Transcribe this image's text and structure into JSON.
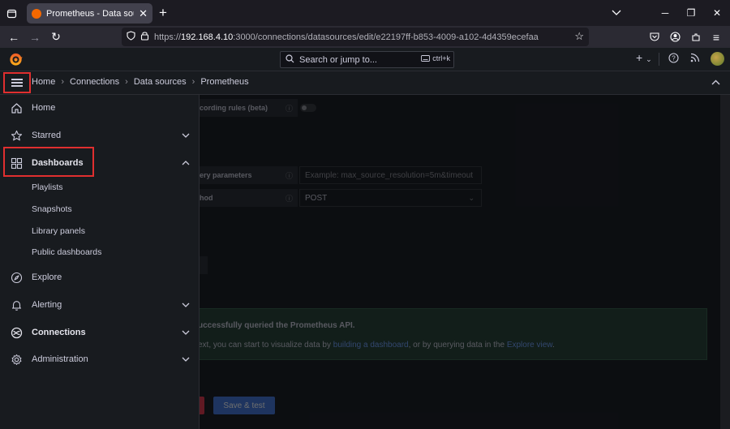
{
  "browser": {
    "tab_title": "Prometheus - Data sources - Co",
    "url_prefix": "https://",
    "url_host": "192.168.4.10",
    "url_rest": ":3000/connections/datasources/edit/e22197ff-b853-4009-a102-4d4359ecefaa"
  },
  "header": {
    "search_placeholder": "Search or jump to...",
    "search_shortcut": "ctrl+k",
    "add_label": "+"
  },
  "breadcrumb": {
    "items": [
      "Home",
      "Connections",
      "Data sources",
      "Prometheus"
    ],
    "separator": "›"
  },
  "sidebar": {
    "items": [
      {
        "label": "Home",
        "icon": "home-icon"
      },
      {
        "label": "Starred",
        "icon": "star-icon"
      },
      {
        "label": "Dashboards",
        "icon": "grid-icon"
      },
      {
        "label": "Explore",
        "icon": "compass-icon"
      },
      {
        "label": "Alerting",
        "icon": "bell-icon"
      },
      {
        "label": "Connections",
        "icon": "connections-icon"
      },
      {
        "label": "Administration",
        "icon": "gear-icon"
      }
    ],
    "dashboard_children": [
      "Playlists",
      "Snapshots",
      "Library panels",
      "Public dashboards"
    ]
  },
  "main": {
    "recording_rules_label": "cording rules (beta)",
    "query_params_label": "ery parameters",
    "query_params_placeholder": "Example: max_source_resolution=5m&timeout",
    "method_label": "hod",
    "method_value": "POST",
    "success_title": "uccessfully queried the Prometheus API.",
    "success_text_prefix": "ext, you can start to visualize data by ",
    "success_link_1": "building a dashboard",
    "success_text_mid": ", or by querying data in the ",
    "success_link_2": "Explore view",
    "success_text_suffix": ".",
    "save_button": "Save & test"
  },
  "colors": {
    "highlight": "#e02f2f",
    "primary_button": "#3d71d9",
    "link": "#6e9fff",
    "grafana_orange": "#f46800"
  }
}
